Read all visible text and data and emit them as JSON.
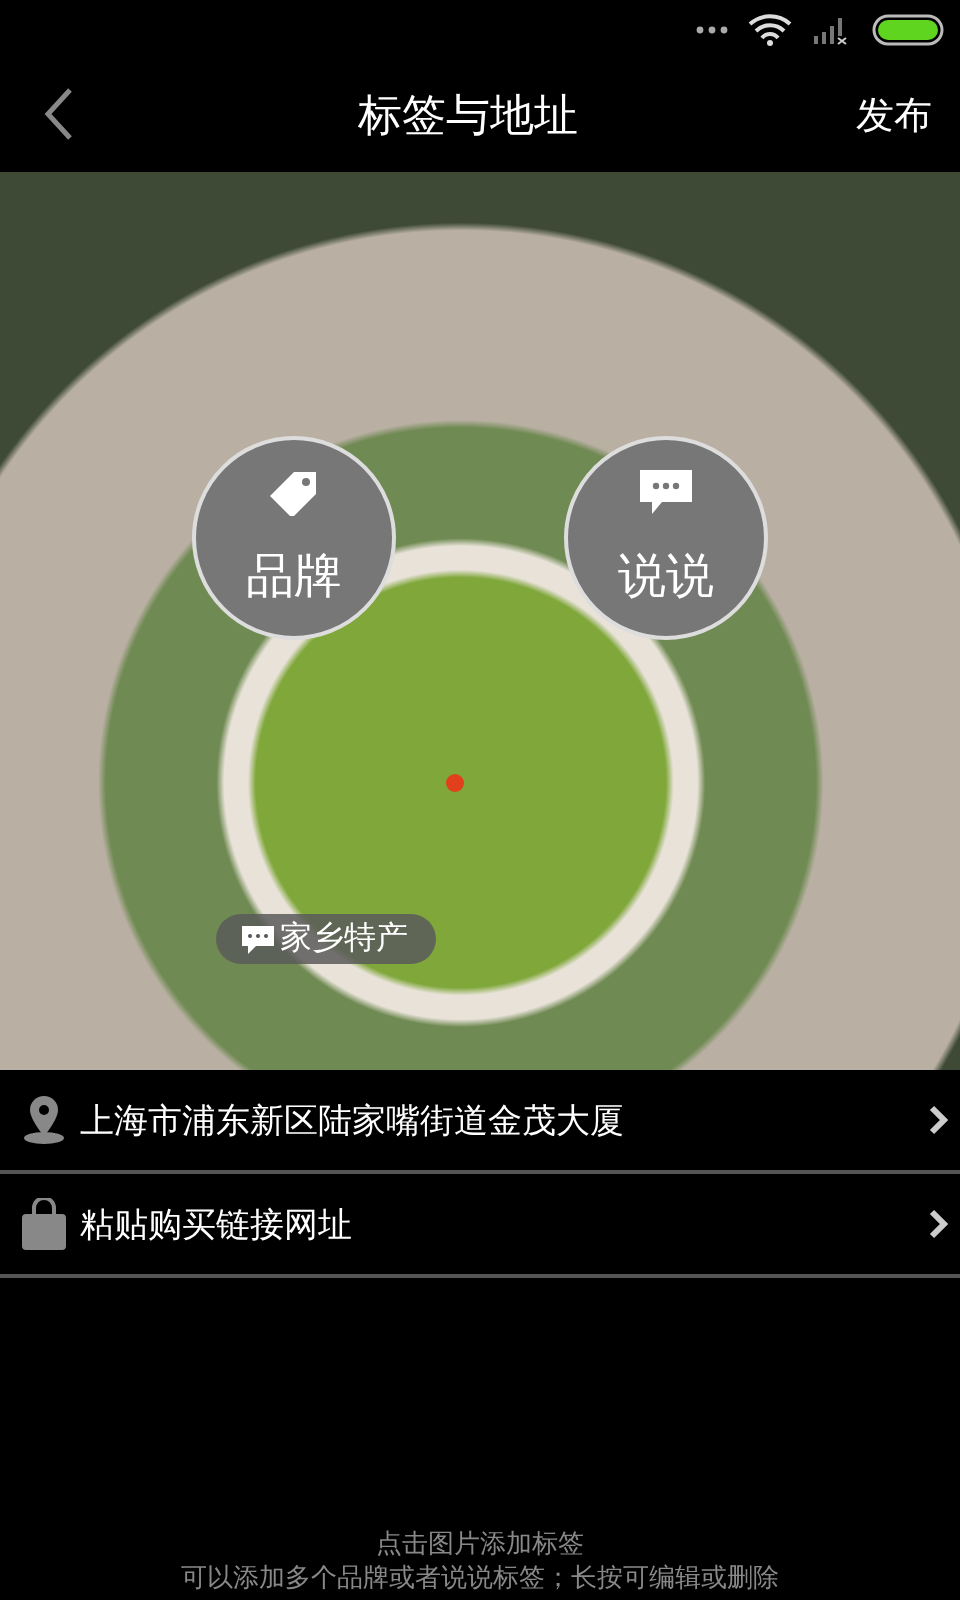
{
  "nav": {
    "title": "标签与地址",
    "action": "发布"
  },
  "photo": {
    "bubbles": [
      {
        "kind": "brand",
        "label": "品牌"
      },
      {
        "kind": "say",
        "label": "说说"
      }
    ],
    "tag": "家乡特产"
  },
  "rows": [
    {
      "kind": "location",
      "label": "上海市浦东新区陆家嘴街道金茂大厦"
    },
    {
      "kind": "link",
      "label": "粘贴购买链接网址"
    }
  ],
  "hints": [
    "点击图片添加标签",
    "可以添加多个品牌或者说说标签；长按可编辑或删除"
  ]
}
